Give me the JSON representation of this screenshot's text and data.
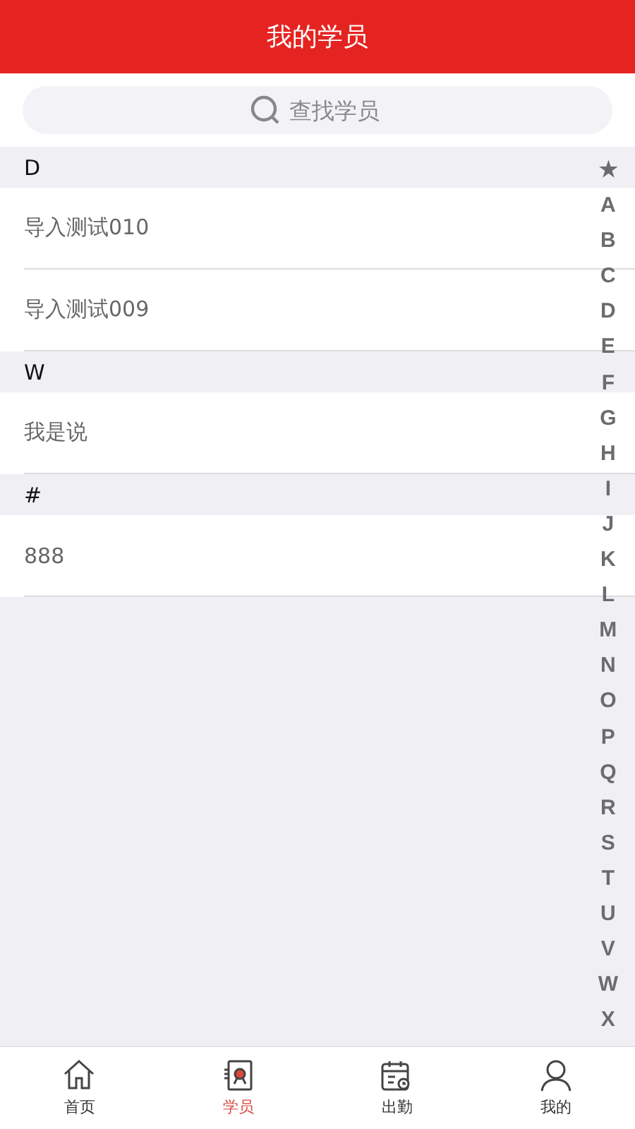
{
  "header": {
    "title": "我的学员"
  },
  "search": {
    "placeholder": "查找学员"
  },
  "sections": [
    {
      "letter": "D",
      "items": [
        "导入测试010",
        "导入测试009"
      ]
    },
    {
      "letter": "W",
      "items": [
        "我是说"
      ]
    },
    {
      "letter": "#",
      "items": [
        "888"
      ]
    }
  ],
  "index": [
    "★",
    "A",
    "B",
    "C",
    "D",
    "E",
    "F",
    "G",
    "H",
    "I",
    "J",
    "K",
    "L",
    "M",
    "N",
    "O",
    "P",
    "Q",
    "R",
    "S",
    "T",
    "U",
    "V",
    "W",
    "X"
  ],
  "tabs": [
    {
      "label": "首页",
      "kind": "home",
      "selected": false
    },
    {
      "label": "学员",
      "kind": "students",
      "selected": true
    },
    {
      "label": "出勤",
      "kind": "attendance",
      "selected": false
    },
    {
      "label": "我的",
      "kind": "profile",
      "selected": false
    }
  ]
}
